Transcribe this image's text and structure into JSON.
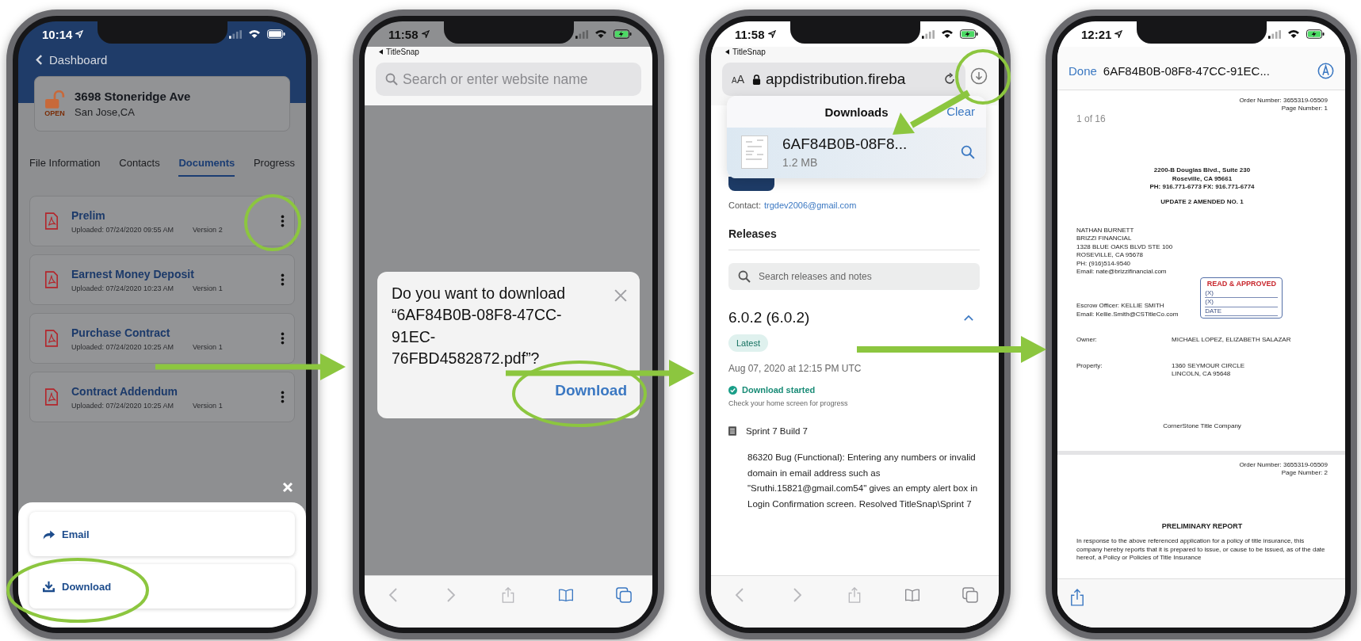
{
  "phones": [
    {
      "kind": "app",
      "status": {
        "time": "10:14",
        "charging": false
      },
      "back": "Dashboard",
      "file": {
        "address": "3698 Stoneridge Ave",
        "city": "San Jose,CA",
        "state": "OPEN"
      },
      "tabs": [
        {
          "label": "File Information",
          "selected": false
        },
        {
          "label": "Contacts",
          "selected": false
        },
        {
          "label": "Documents",
          "selected": true
        },
        {
          "label": "Progress",
          "selected": false
        }
      ],
      "documents": [
        {
          "name": "Prelim",
          "uploaded": "Uploaded: 07/24/2020 09:55 AM",
          "version": "Version 2"
        },
        {
          "name": "Earnest Money Deposit",
          "uploaded": "Uploaded: 07/24/2020 10:23 AM",
          "version": "Version 1"
        },
        {
          "name": "Purchase Contract",
          "uploaded": "Uploaded: 07/24/2020 10:25 AM",
          "version": "Version 1"
        },
        {
          "name": "Contract Addendum",
          "uploaded": "Uploaded: 07/24/2020 10:25 AM",
          "version": "Version 1"
        }
      ],
      "actions": [
        {
          "kind": "email",
          "label": "Email"
        },
        {
          "kind": "download",
          "label": "Download"
        }
      ]
    },
    {
      "kind": "download_prompt",
      "status": {
        "time": "11:58",
        "charging": true
      },
      "back": "TitleSnap",
      "search": {
        "placeholder": "Search or enter website name"
      },
      "dialog": {
        "message": "Do you want to download “6AF84B0B-08F8-47CC-91EC-76FBD4582872.pdf”?",
        "button": "Download"
      }
    },
    {
      "kind": "downloads",
      "status": {
        "time": "11:58",
        "charging": true
      },
      "back": "TitleSnap",
      "address_bar": {
        "text_size": "AA",
        "url": "appdistribution.fireba"
      },
      "downloads": {
        "title": "Downloads",
        "clear": "Clear",
        "file": {
          "name": "6AF84B0B-08F8...",
          "size": "1.2 MB"
        }
      },
      "contact": {
        "label": "Contact:",
        "email": "trgdev2006@gmail.com"
      },
      "releases": {
        "title": "Releases",
        "search": {
          "placeholder": "Search releases and notes"
        },
        "version": "6.0.2 (6.0.2)",
        "badge": "Latest",
        "date": "Aug 07, 2020 at 12:15 PM UTC",
        "status": "Download started",
        "hint": "Check your home screen for progress",
        "notes_title": "Sprint 7 Build 7",
        "notes": "86320 Bug (Functional): Entering any numbers or invalid domain in email address such as \"Sruthi.15821@gmail.com54\" gives an empty alert box in Login Confirmation screen. Resolved TitleSnap\\Sprint 7"
      }
    },
    {
      "kind": "pdf_viewer",
      "status": {
        "time": "12:21",
        "charging": true
      },
      "done": "Done",
      "title": "6AF84B0B-08F8-47CC-91EC...",
      "page_indicator": "1 of 16",
      "pages": [
        {
          "order": "Order Number: 3655319-05509",
          "page": "Page Number: 1",
          "letterhead": [
            "2200-B Douglas Blvd.,  Suite 230",
            "Roseville, CA 95661",
            "PH: 916.771-6773  FX: 916.771-6774"
          ],
          "heading": "UPDATE 2 AMENDED NO. 1",
          "recipient": [
            "NATHAN BURNETT",
            "BRIZZI FINANCIAL",
            "1328 BLUE OAKS BLVD STE 100",
            "ROSEVILLE,  CA 95678",
            "PH: (916)514-9540",
            "Email: nate@brizzifinancial.com"
          ],
          "stamp": {
            "title": "READ & APPROVED",
            "lines": [
              "(X)",
              "(X)",
              "DATE"
            ]
          },
          "escrow": [
            "Escrow Officer: KELLIE SMITH",
            "Email:  Kellie.Smith@CSTitleCo.com"
          ],
          "fields": [
            {
              "label": "Owner:",
              "value": [
                "MICHAEL LOPEZ, ELIZABETH SALAZAR"
              ]
            },
            {
              "label": "Property:",
              "value": [
                "1360 SEYMOUR CIRCLE",
                "LINCOLN, CA 95648"
              ]
            }
          ],
          "footer": "CornerStone Title Company"
        },
        {
          "order": "Order Number: 3655319-05509",
          "page": "Page Number: 2",
          "title": "PRELIMINARY REPORT",
          "paragraph": "In response to the above referenced application for a policy of title insurance, this company hereby reports that it is prepared to issue, or cause to be issued, as of the date hereof, a Policy or Policies of Title Insurance"
        }
      ]
    }
  ]
}
